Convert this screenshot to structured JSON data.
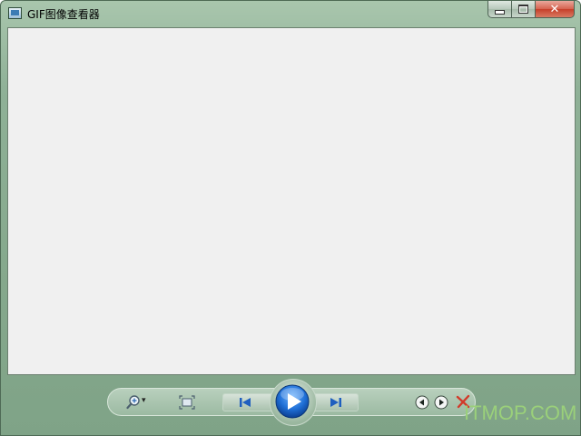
{
  "window": {
    "title": "GIF图像查看器"
  },
  "caption": {
    "minimize_icon": "minimize-icon",
    "maximize_icon": "maximize-icon",
    "close_label": "✕"
  },
  "toolbar": {
    "zoom_dropdown_glyph": "▾",
    "icons": [
      "zoom-icon",
      "fit-to-window-icon",
      "previous-icon",
      "play-icon",
      "next-icon",
      "rotate-left-icon",
      "rotate-right-icon",
      "delete-icon"
    ]
  },
  "watermark": {
    "text": "ITMOP.COM"
  },
  "colors": {
    "frame": "#8fb197",
    "viewer_bg": "#f0f0f0",
    "play_blue": "#1f6fd6",
    "delete_red": "#d23a2a",
    "watermark": "#9ad07a"
  }
}
